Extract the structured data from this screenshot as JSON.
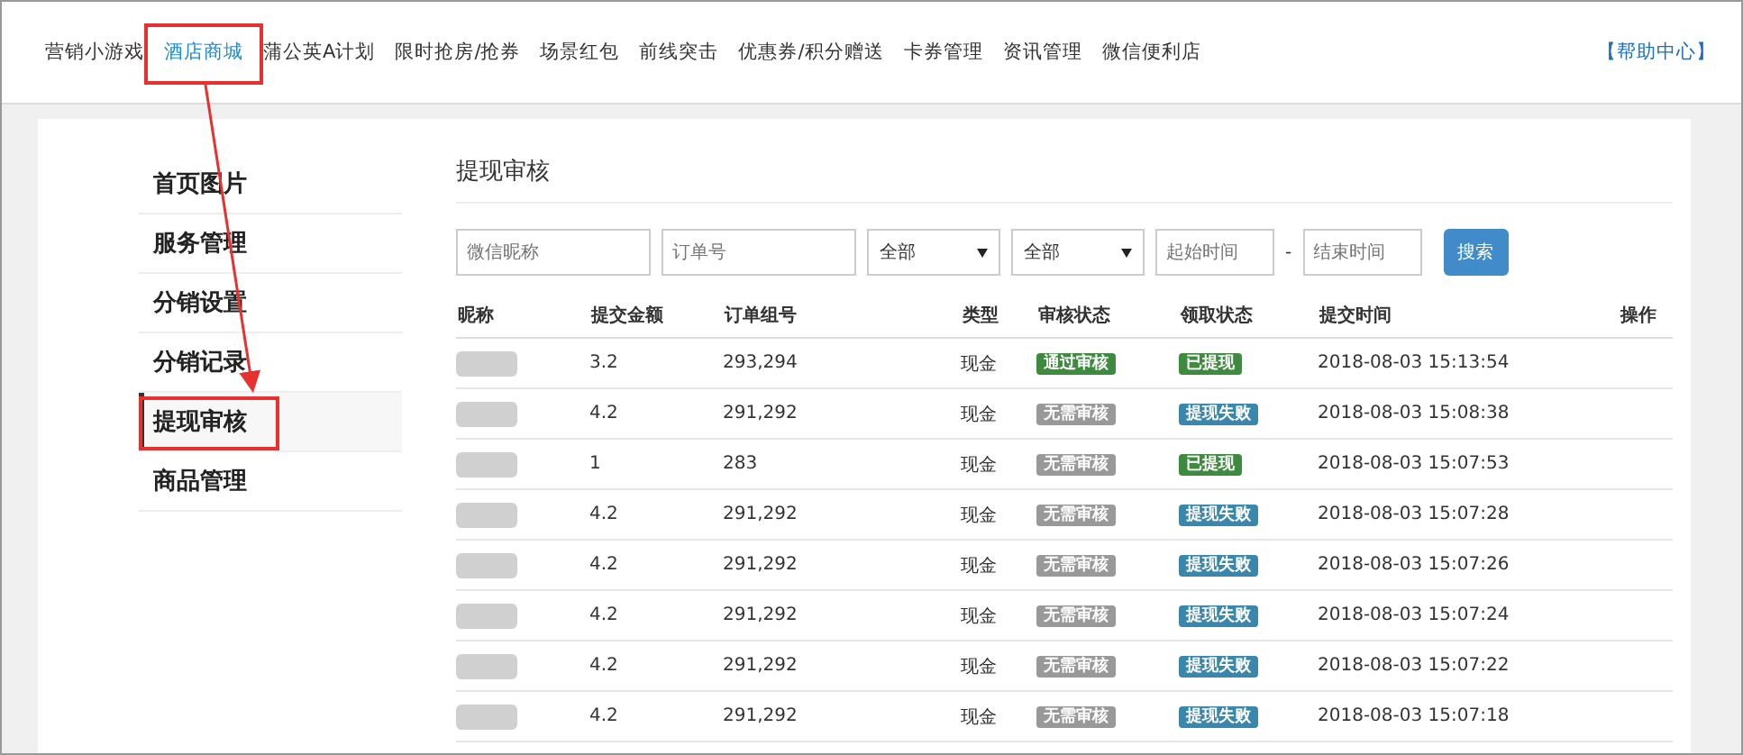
{
  "nav": {
    "items": [
      {
        "label": "营销小游戏",
        "selected": false
      },
      {
        "label": "酒店商城",
        "selected": true
      },
      {
        "label": "蒲公英A计划",
        "selected": false
      },
      {
        "label": "限时抢房/抢券",
        "selected": false
      },
      {
        "label": "场景红包",
        "selected": false
      },
      {
        "label": "前线突击",
        "selected": false
      },
      {
        "label": "优惠券/积分赠送",
        "selected": false
      },
      {
        "label": "卡券管理",
        "selected": false
      },
      {
        "label": "资讯管理",
        "selected": false
      },
      {
        "label": "微信便利店",
        "selected": false
      }
    ],
    "help": "【帮助中心】"
  },
  "sidebar": {
    "items": [
      {
        "label": "首页图片",
        "selected": false
      },
      {
        "label": "服务管理",
        "selected": false
      },
      {
        "label": "分销设置",
        "selected": false
      },
      {
        "label": "分销记录",
        "selected": false
      },
      {
        "label": "提现审核",
        "selected": true
      },
      {
        "label": "商品管理",
        "selected": false
      }
    ]
  },
  "page_title": "提现审核",
  "filters": {
    "nickname": {
      "placeholder": "微信昵称"
    },
    "order": {
      "placeholder": "订单号"
    },
    "audit_select": "全部",
    "claim_select": "全部",
    "start": {
      "placeholder": "起始时间"
    },
    "separator": "-",
    "end": {
      "placeholder": "结束时间"
    },
    "search_button": "搜索"
  },
  "table": {
    "columns": [
      "昵称",
      "提交金额",
      "订单组号",
      "类型",
      "审核状态",
      "领取状态",
      "提交时间",
      "操作"
    ],
    "rows": [
      {
        "amount": "3.2",
        "orders": "293,294",
        "type": "现金",
        "audit": {
          "text": "通过审核",
          "color": "#3e8a3e"
        },
        "claim": {
          "text": "已提现",
          "color": "#3e8a3e"
        },
        "time": "2018-08-03 15:13:54"
      },
      {
        "amount": "4.2",
        "orders": "291,292",
        "type": "现金",
        "audit": {
          "text": "无需审核",
          "color": "#999999"
        },
        "claim": {
          "text": "提现失败",
          "color": "#3a87ad"
        },
        "time": "2018-08-03 15:08:38"
      },
      {
        "amount": "1",
        "orders": "283",
        "type": "现金",
        "audit": {
          "text": "无需审核",
          "color": "#999999"
        },
        "claim": {
          "text": "已提现",
          "color": "#3e8a3e"
        },
        "time": "2018-08-03 15:07:53"
      },
      {
        "amount": "4.2",
        "orders": "291,292",
        "type": "现金",
        "audit": {
          "text": "无需审核",
          "color": "#999999"
        },
        "claim": {
          "text": "提现失败",
          "color": "#3a87ad"
        },
        "time": "2018-08-03 15:07:28"
      },
      {
        "amount": "4.2",
        "orders": "291,292",
        "type": "现金",
        "audit": {
          "text": "无需审核",
          "color": "#999999"
        },
        "claim": {
          "text": "提现失败",
          "color": "#3a87ad"
        },
        "time": "2018-08-03 15:07:26"
      },
      {
        "amount": "4.2",
        "orders": "291,292",
        "type": "现金",
        "audit": {
          "text": "无需审核",
          "color": "#999999"
        },
        "claim": {
          "text": "提现失败",
          "color": "#3a87ad"
        },
        "time": "2018-08-03 15:07:24"
      },
      {
        "amount": "4.2",
        "orders": "291,292",
        "type": "现金",
        "audit": {
          "text": "无需审核",
          "color": "#999999"
        },
        "claim": {
          "text": "提现失败",
          "color": "#3a87ad"
        },
        "time": "2018-08-03 15:07:22"
      },
      {
        "amount": "4.2",
        "orders": "291,292",
        "type": "现金",
        "audit": {
          "text": "无需审核",
          "color": "#999999"
        },
        "claim": {
          "text": "提现失败",
          "color": "#3a87ad"
        },
        "time": "2018-08-03 15:07:18"
      }
    ]
  }
}
